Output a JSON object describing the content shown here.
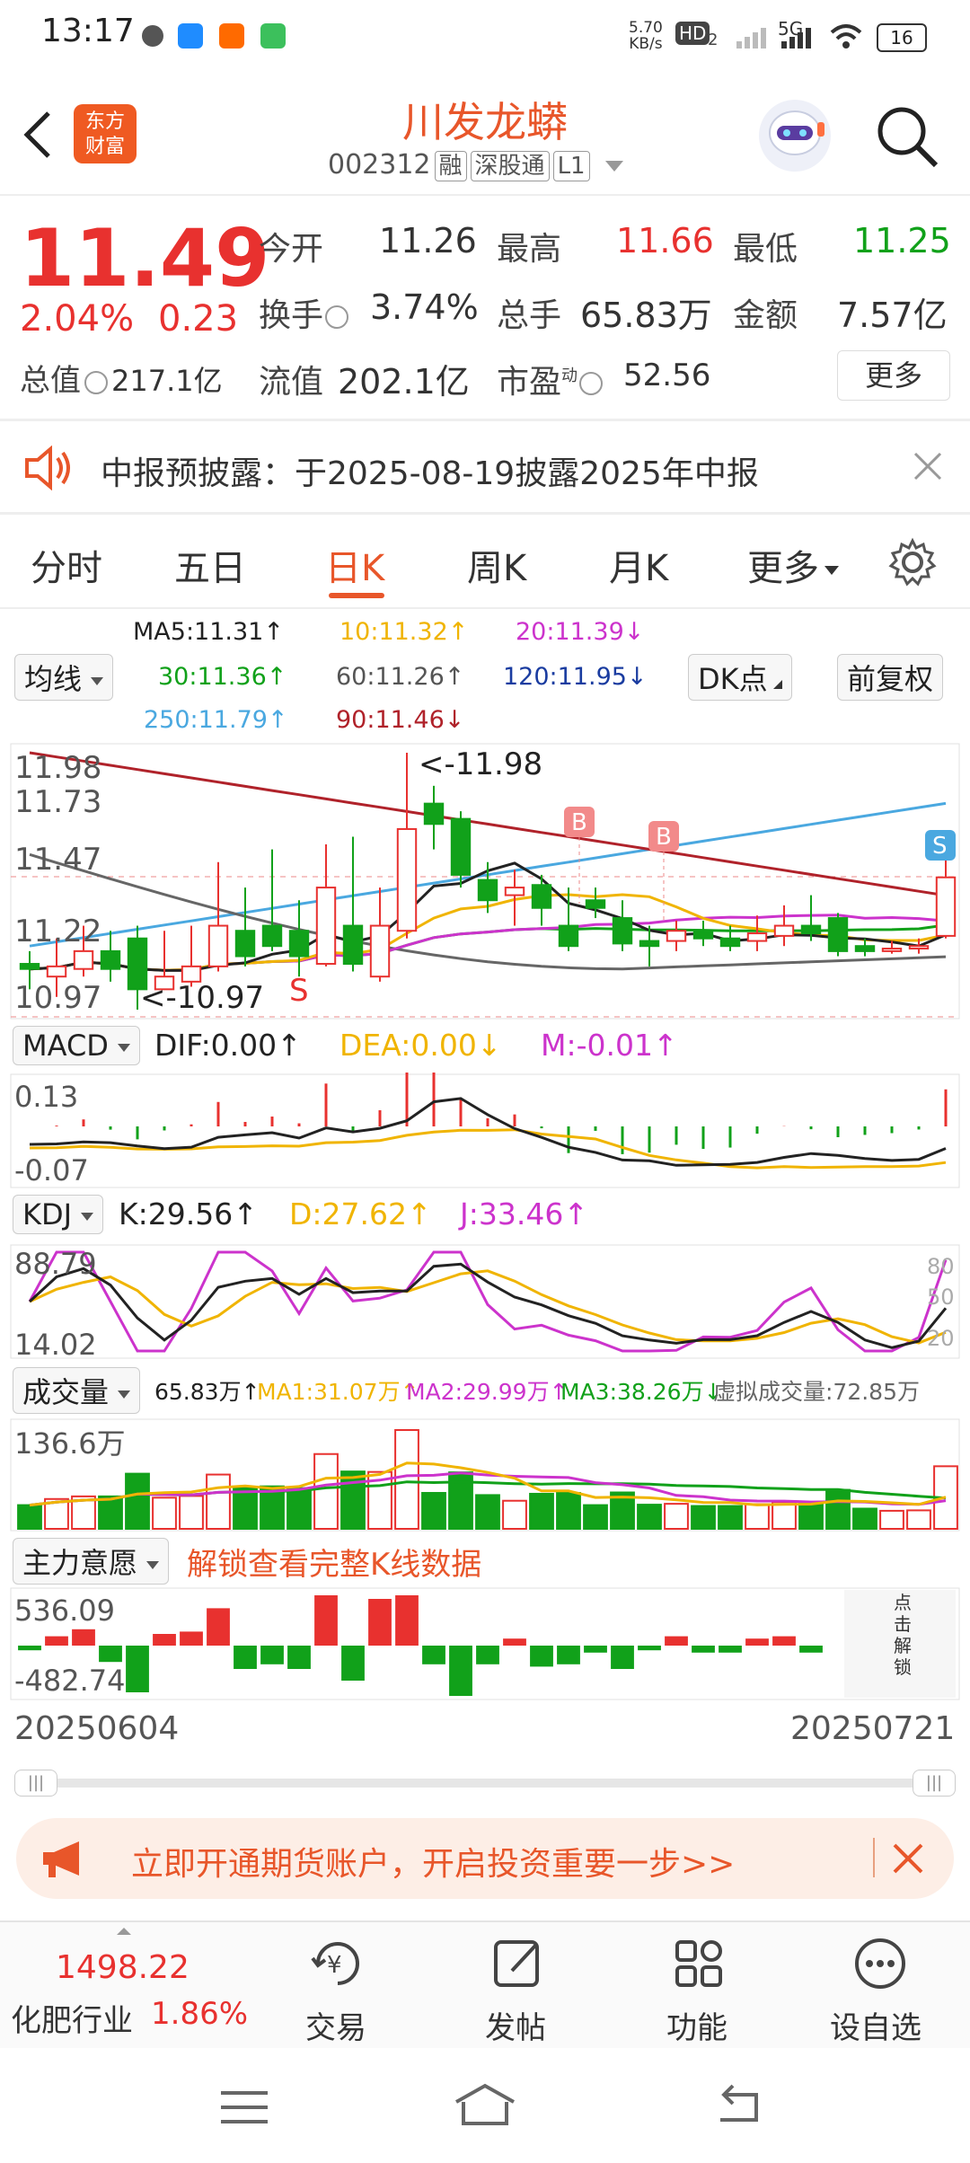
{
  "status_bar": {
    "time": "13:17",
    "net_speed_top": "5.70",
    "net_speed_unit": "KB/s",
    "hd": "HD",
    "hd_sub": "2",
    "network": "5G",
    "battery": "16"
  },
  "header": {
    "logo_line1": "东方",
    "logo_line2": "财富",
    "title": "川发龙蟒",
    "code": "002312",
    "tags": [
      "融",
      "深股通",
      "L1"
    ]
  },
  "quote": {
    "price": "11.49",
    "change_pct": "2.04%",
    "change": "0.23",
    "open_label": "今开",
    "open": "11.26",
    "high_label": "最高",
    "high": "11.66",
    "low_label": "最低",
    "low": "11.25",
    "turnover_label": "换手",
    "turnover": "3.74%",
    "volume_label": "总手",
    "volume": "65.83万",
    "amount_label": "金额",
    "amount": "7.57亿",
    "mcap_label": "总值",
    "mcap": "217.1亿",
    "float_label": "流值",
    "float_mcap": "202.1亿",
    "pe_label": "市盈",
    "pe_sup": "动",
    "pe": "52.56",
    "more_button": "更多"
  },
  "notice": {
    "text": "中报预披露：于2025-08-19披露2025年中报"
  },
  "tabs": [
    "分时",
    "五日",
    "日K",
    "周K",
    "月K",
    "更多"
  ],
  "active_tab": 2,
  "ma_panel": {
    "selector": "均线",
    "ma5": "MA5:11.31↑",
    "ma10": "10:11.32↑",
    "ma20": "20:11.39↓",
    "ma30": "30:11.36↑",
    "ma60": "60:11.26↑",
    "ma120": "120:11.95↓",
    "ma250": "250:11.79↑",
    "ma90": "90:11.46↓",
    "dk_button": "DK点",
    "adjust_button": "前复权"
  },
  "kline": {
    "y_top": "11.98",
    "y2": "11.73",
    "y3": "11.47",
    "y4": "11.22",
    "y_bottom": "10.97",
    "max_marker": "<-11.98",
    "min_marker": "<-10.97",
    "buy_marker": "B",
    "sell_marker": "S",
    "s_badge": "S"
  },
  "macd": {
    "selector": "MACD",
    "dif": "DIF:0.00↑",
    "dea": "DEA:0.00↓",
    "m": "M:-0.01↑",
    "y_top": "0.13",
    "y_bottom": "-0.07"
  },
  "kdj": {
    "selector": "KDJ",
    "k": "K:29.56↑",
    "d": "D:27.62↑",
    "j": "J:33.46↑",
    "y_top": "88.79",
    "y_bottom": "14.02",
    "r80": "80",
    "r50": "50",
    "r20": "20"
  },
  "volume": {
    "selector": "成交量",
    "vol": "65.83万↑",
    "ma1": "MA1:31.07万↑",
    "ma2": "MA2:29.99万↑",
    "ma3": "MA3:38.26万↓",
    "virtual": "虚拟成交量:72.85万",
    "y_top": "136.6万"
  },
  "main_force": {
    "selector": "主力意愿",
    "unlock": "解锁查看完整K线数据",
    "y_top": "536.09",
    "y_bottom": "-482.74",
    "unlock_side": "点击解锁"
  },
  "date_range": {
    "start": "20250604",
    "end": "20250721"
  },
  "ad_banner": {
    "text": "立即开通期货账户，开启投资重要一步>>"
  },
  "bottom_bar": {
    "index_value": "1498.22",
    "index_name": "化肥行业",
    "index_change": "1.86%",
    "trade": "交易",
    "post": "发帖",
    "func": "功能",
    "watch": "设自选"
  },
  "chart_data": {
    "type": "candlestick",
    "x_range": [
      "20250604",
      "20250721"
    ],
    "ylim": [
      10.97,
      11.98
    ],
    "candles": [
      {
        "o": 11.15,
        "c": 11.13,
        "h": 11.2,
        "l": 11.05
      },
      {
        "o": 11.1,
        "c": 11.14,
        "h": 11.25,
        "l": 11.02
      },
      {
        "o": 11.13,
        "c": 11.2,
        "h": 11.3,
        "l": 11.1
      },
      {
        "o": 11.2,
        "c": 11.13,
        "h": 11.28,
        "l": 11.08
      },
      {
        "o": 11.25,
        "c": 11.05,
        "h": 11.3,
        "l": 10.97
      },
      {
        "o": 11.05,
        "c": 11.1,
        "h": 11.28,
        "l": 11.05
      },
      {
        "o": 11.08,
        "c": 11.14,
        "h": 11.3,
        "l": 11.06
      },
      {
        "o": 11.14,
        "c": 11.3,
        "h": 11.55,
        "l": 11.12
      },
      {
        "o": 11.28,
        "c": 11.18,
        "h": 11.45,
        "l": 11.14
      },
      {
        "o": 11.3,
        "c": 11.22,
        "h": 11.6,
        "l": 11.2
      },
      {
        "o": 11.28,
        "c": 11.18,
        "h": 11.4,
        "l": 11.1
      },
      {
        "o": 11.15,
        "c": 11.45,
        "h": 11.62,
        "l": 11.14
      },
      {
        "o": 11.3,
        "c": 11.15,
        "h": 11.65,
        "l": 11.12
      },
      {
        "o": 11.1,
        "c": 11.3,
        "h": 11.45,
        "l": 11.08
      },
      {
        "o": 11.28,
        "c": 11.68,
        "h": 11.98,
        "l": 11.25
      },
      {
        "o": 11.78,
        "c": 11.7,
        "h": 11.85,
        "l": 11.6
      },
      {
        "o": 11.72,
        "c": 11.5,
        "h": 11.75,
        "l": 11.45
      },
      {
        "o": 11.48,
        "c": 11.4,
        "h": 11.55,
        "l": 11.35
      },
      {
        "o": 11.42,
        "c": 11.45,
        "h": 11.52,
        "l": 11.3
      },
      {
        "o": 11.46,
        "c": 11.37,
        "h": 11.5,
        "l": 11.3
      },
      {
        "o": 11.3,
        "c": 11.22,
        "h": 11.45,
        "l": 11.2
      },
      {
        "o": 11.4,
        "c": 11.37,
        "h": 11.45,
        "l": 11.33
      },
      {
        "o": 11.33,
        "c": 11.23,
        "h": 11.4,
        "l": 11.2
      },
      {
        "o": 11.24,
        "c": 11.22,
        "h": 11.3,
        "l": 11.14
      },
      {
        "o": 11.24,
        "c": 11.28,
        "h": 11.32,
        "l": 11.2
      },
      {
        "o": 11.28,
        "c": 11.25,
        "h": 11.32,
        "l": 11.22
      },
      {
        "o": 11.25,
        "c": 11.22,
        "h": 11.3,
        "l": 11.2
      },
      {
        "o": 11.24,
        "c": 11.27,
        "h": 11.34,
        "l": 11.2
      },
      {
        "o": 11.26,
        "c": 11.3,
        "h": 11.38,
        "l": 11.22
      },
      {
        "o": 11.3,
        "c": 11.27,
        "h": 11.42,
        "l": 11.24
      },
      {
        "o": 11.33,
        "c": 11.2,
        "h": 11.35,
        "l": 11.18
      },
      {
        "o": 11.22,
        "c": 11.2,
        "h": 11.25,
        "l": 11.18
      },
      {
        "o": 11.2,
        "c": 11.21,
        "h": 11.24,
        "l": 11.19
      },
      {
        "o": 11.21,
        "c": 11.22,
        "h": 11.25,
        "l": 11.19
      },
      {
        "o": 11.26,
        "c": 11.49,
        "h": 11.66,
        "l": 11.25
      }
    ]
  },
  "colors": {
    "accent": "#e8562a",
    "up": "#e8312f",
    "down": "#11a11a",
    "yellow": "#f0b400",
    "magenta": "#cc33cc"
  }
}
